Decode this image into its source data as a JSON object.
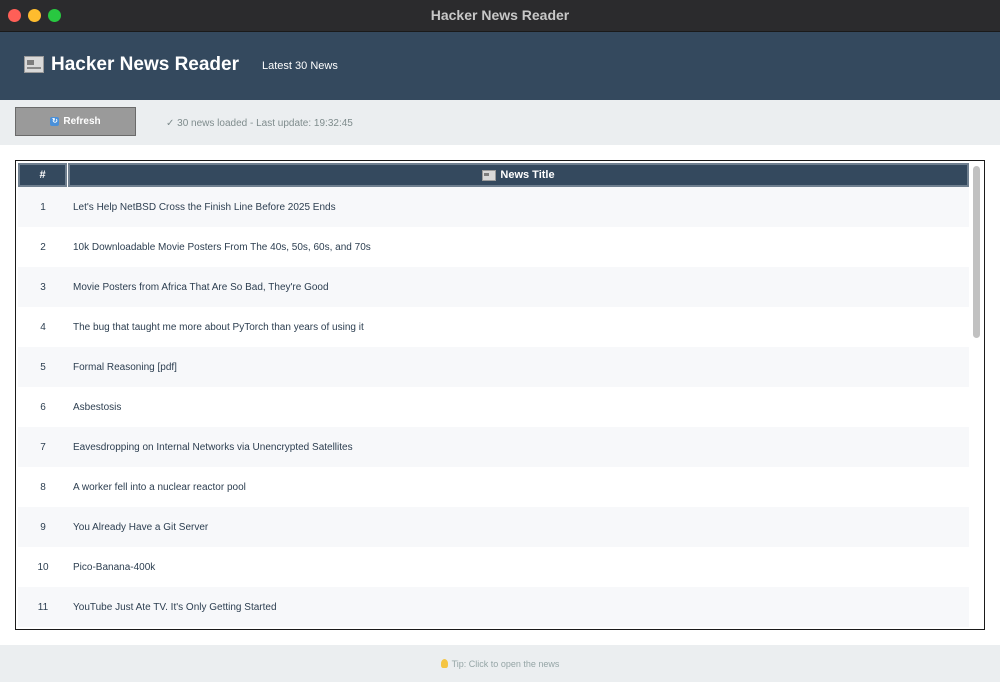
{
  "window": {
    "title": "Hacker News Reader"
  },
  "header": {
    "icon": "newspaper-icon",
    "title": "Hacker News Reader",
    "subtitle": "Latest 30 News"
  },
  "toolbar": {
    "refresh_icon": "refresh-icon",
    "refresh_label": "Refresh",
    "status": "✓ 30 news loaded - Last update: 19:32:45"
  },
  "table": {
    "columns": {
      "num": "#",
      "title": "News Title",
      "title_icon": "newspaper-icon"
    },
    "rows": [
      {
        "num": "1",
        "title": "Let's Help NetBSD Cross the Finish Line Before 2025 Ends"
      },
      {
        "num": "2",
        "title": "10k Downloadable Movie Posters From The 40s, 50s, 60s, and 70s"
      },
      {
        "num": "3",
        "title": "Movie Posters from Africa That Are So Bad, They're Good"
      },
      {
        "num": "4",
        "title": "The bug that taught me more about PyTorch than years of using it"
      },
      {
        "num": "5",
        "title": "Formal Reasoning [pdf]"
      },
      {
        "num": "6",
        "title": "Asbestosis"
      },
      {
        "num": "7",
        "title": "Eavesdropping on Internal Networks via Unencrypted Satellites"
      },
      {
        "num": "8",
        "title": "A worker fell into a nuclear reactor pool"
      },
      {
        "num": "9",
        "title": "You Already Have a Git Server"
      },
      {
        "num": "10",
        "title": "Pico-Banana-400k"
      },
      {
        "num": "11",
        "title": "YouTube Just Ate TV. It's Only Getting Started"
      }
    ]
  },
  "footer": {
    "icon": "lightbulb-icon",
    "tip": "Tip: Click to open the news"
  },
  "colors": {
    "header_bg": "#34495e",
    "toolbar_bg": "#ebeef0",
    "button_bg": "#9a9a9a"
  }
}
